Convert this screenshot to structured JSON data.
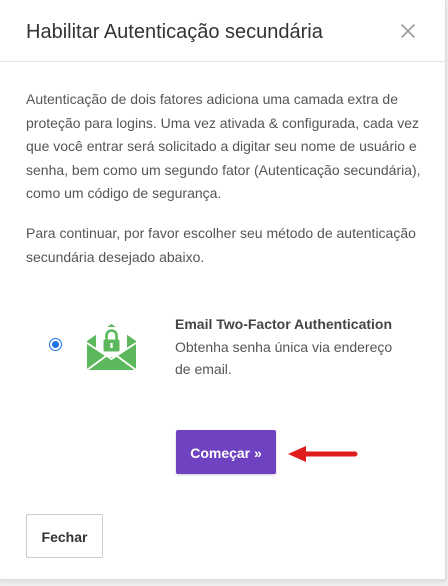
{
  "modal": {
    "title": "Habilitar Autenticação secundária",
    "intro_text": "Autenticação de dois fatores adiciona uma camada extra de proteção para logins. Uma vez ativada & configurada, cada vez que você entrar será solicitado a digitar seu nome de usuário e senha, bem como um segundo fator (Autenticação secundária), como um código de segurança.",
    "instruction_text": "Para continuar, por favor escolher seu método de autenticação secundária desejado abaixo."
  },
  "method": {
    "title": "Email Two-Factor Authentication",
    "description": "Obtenha senha única via endereço de email.",
    "selected": true,
    "icon": "envelope-lock-icon"
  },
  "buttons": {
    "start_label": "Começar »",
    "close_label": "Fechar"
  },
  "colors": {
    "primary": "#6f42c1",
    "icon_green": "#5cb85c",
    "arrow_red": "#e01b1b",
    "radio_blue": "#1a73e8"
  }
}
